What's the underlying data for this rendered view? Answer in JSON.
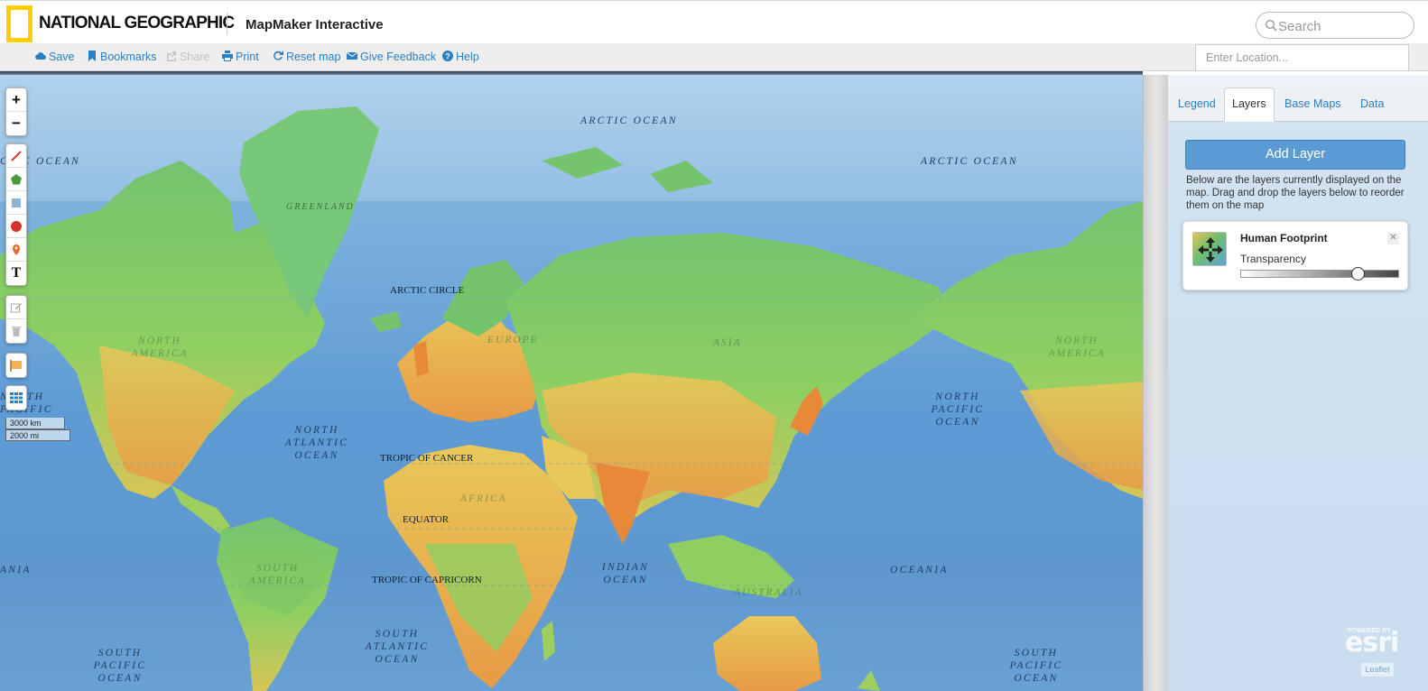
{
  "header": {
    "brand": "NATIONAL GEOGRAPHIC",
    "app_title": "MapMaker Interactive",
    "search_placeholder": "Search"
  },
  "toolbar": {
    "items": [
      {
        "label": "Save",
        "icon": "cloud-icon",
        "enabled": true
      },
      {
        "label": "Bookmarks",
        "icon": "bookmark-icon",
        "enabled": true
      },
      {
        "label": "Share",
        "icon": "share-icon",
        "enabled": false
      },
      {
        "label": "Print",
        "icon": "print-icon",
        "enabled": true
      },
      {
        "label": "Reset map",
        "icon": "refresh-icon",
        "enabled": true
      },
      {
        "label": "Give Feedback",
        "icon": "envelope-icon",
        "enabled": true
      },
      {
        "label": "Help",
        "icon": "help-icon",
        "enabled": true
      }
    ],
    "location_placeholder": "Enter Location..."
  },
  "map": {
    "zoom_in": "+",
    "zoom_out": "−",
    "draw_tools": [
      "line-tool-icon",
      "polygon-tool-icon",
      "rectangle-tool-icon",
      "circle-tool-icon",
      "marker-tool-icon",
      "text-tool-icon"
    ],
    "text_tool_glyph": "T",
    "edit_tools": [
      "edit-icon",
      "delete-icon"
    ],
    "scale_km": "3000 km",
    "scale_mi": "2000 mi",
    "labels": {
      "arctic_ocean": "ARCTIC OCEAN",
      "arctic_ocean_left": "CTIC OCEAN",
      "greenland": "GREENLAND",
      "arctic_circle": "ARCTIC CIRCLE",
      "north_america": "NORTH AMERICA",
      "europe": "EUROPE",
      "asia": "ASIA",
      "north_atlantic_ocean": "NORTH ATLANTIC OCEAN",
      "north_pacific_ocean": "NORTH PACIFIC OCEAN",
      "north_pacific_left": "NORTH PACIFIC",
      "tropic_of_cancer": "TROPIC OF CANCER",
      "africa": "AFRICA",
      "equator": "EQUATOR",
      "south_america": "SOUTH AMERICA",
      "indian_ocean": "INDIAN OCEAN",
      "tropic_of_capricorn": "TROPIC OF CAPRICORN",
      "australia": "AUSTRALIA",
      "oceania": "OCEANIA",
      "oceania_left": "ANIA",
      "south_atlantic_ocean": "SOUTH ATLANTIC OCEAN",
      "south_pacific_ocean": "SOUTH PACIFIC OCEAN"
    }
  },
  "panel": {
    "tabs": [
      "Legend",
      "Layers",
      "Base Maps",
      "Data"
    ],
    "active_tab": "Layers",
    "add_layer": "Add Layer",
    "description": "Below are the layers currently displayed on the map. Drag and drop the layers below to reorder them on the map",
    "layers": [
      {
        "name": "Human Footprint",
        "transparency_label": "Transparency",
        "transparency": 0.74
      }
    ],
    "esri_powered": "POWERED BY",
    "esri": "esri",
    "leaflet": "Leaflet"
  },
  "colors": {
    "link": "#2a7fc2",
    "logo_yellow": "#ffce00",
    "add_layer": "#5b9bd4",
    "ocean": "#5e9bd4",
    "land_low": "#6dbf68",
    "land_mid": "#e9c85a",
    "land_high": "#e8893a"
  }
}
